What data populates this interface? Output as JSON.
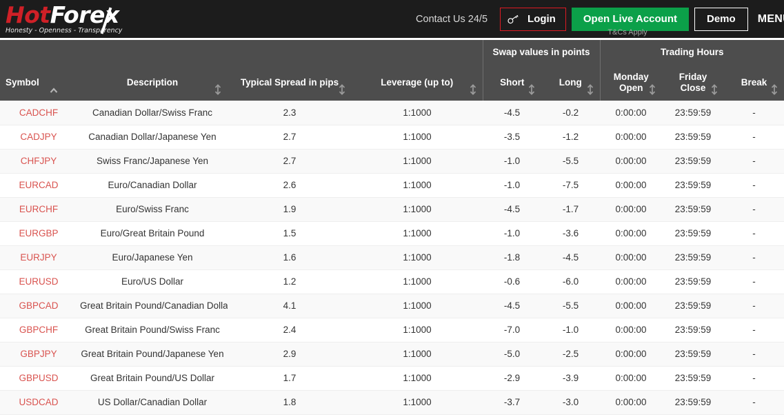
{
  "topbar": {
    "logo": {
      "part1": "Hot",
      "part2": "Forex",
      "tagline": "Honesty - Openness - Transparency"
    },
    "contact": "Contact Us 24/5",
    "login_label": "Login",
    "live_account_label": "Open Live Account",
    "demo_label": "Demo",
    "tcs": "T&Cs Apply",
    "menu_label": "MENU",
    "colors": {
      "accent_red": "#e01a22",
      "accent_green": "#0ba049",
      "bar_bg": "#1c1c1c"
    }
  },
  "table": {
    "group_headers": {
      "swap": "Swap values in points",
      "trading_hours": "Trading Hours"
    },
    "columns": [
      {
        "label": "Symbol",
        "sort": "asc"
      },
      {
        "label": "Description",
        "sort": "none"
      },
      {
        "label": "Typical Spread in pips",
        "sort": "none"
      },
      {
        "label": "Leverage (up to)",
        "sort": "none"
      },
      {
        "label": "Short",
        "sort": "none"
      },
      {
        "label": "Long",
        "sort": "none"
      },
      {
        "label": "Monday Open",
        "sort": "none"
      },
      {
        "label": "Friday Close",
        "sort": "none"
      },
      {
        "label": "Break",
        "sort": "none"
      }
    ],
    "rows": [
      {
        "symbol": "CADCHF",
        "description": "Canadian Dollar/Swiss Franc",
        "spread": "2.3",
        "leverage": "1:1000",
        "short": "-4.5",
        "long": "-0.2",
        "monday_open": "0:00:00",
        "friday_close": "23:59:59",
        "break": "-"
      },
      {
        "symbol": "CADJPY",
        "description": "Canadian Dollar/Japanese Yen",
        "spread": "2.7",
        "leverage": "1:1000",
        "short": "-3.5",
        "long": "-1.2",
        "monday_open": "0:00:00",
        "friday_close": "23:59:59",
        "break": "-"
      },
      {
        "symbol": "CHFJPY",
        "description": "Swiss Franc/Japanese Yen",
        "spread": "2.7",
        "leverage": "1:1000",
        "short": "-1.0",
        "long": "-5.5",
        "monday_open": "0:00:00",
        "friday_close": "23:59:59",
        "break": "-"
      },
      {
        "symbol": "EURCAD",
        "description": "Euro/Canadian Dollar",
        "spread": "2.6",
        "leverage": "1:1000",
        "short": "-1.0",
        "long": "-7.5",
        "monday_open": "0:00:00",
        "friday_close": "23:59:59",
        "break": "-"
      },
      {
        "symbol": "EURCHF",
        "description": "Euro/Swiss Franc",
        "spread": "1.9",
        "leverage": "1:1000",
        "short": "-4.5",
        "long": "-1.7",
        "monday_open": "0:00:00",
        "friday_close": "23:59:59",
        "break": "-"
      },
      {
        "symbol": "EURGBP",
        "description": "Euro/Great Britain Pound",
        "spread": "1.5",
        "leverage": "1:1000",
        "short": "-1.0",
        "long": "-3.6",
        "monday_open": "0:00:00",
        "friday_close": "23:59:59",
        "break": "-"
      },
      {
        "symbol": "EURJPY",
        "description": "Euro/Japanese Yen",
        "spread": "1.6",
        "leverage": "1:1000",
        "short": "-1.8",
        "long": "-4.5",
        "monday_open": "0:00:00",
        "friday_close": "23:59:59",
        "break": "-"
      },
      {
        "symbol": "EURUSD",
        "description": "Euro/US Dollar",
        "spread": "1.2",
        "leverage": "1:1000",
        "short": "-0.6",
        "long": "-6.0",
        "monday_open": "0:00:00",
        "friday_close": "23:59:59",
        "break": "-"
      },
      {
        "symbol": "GBPCAD",
        "description": "Great Britain Pound/Canadian Dollar",
        "spread": "4.1",
        "leverage": "1:1000",
        "short": "-4.5",
        "long": "-5.5",
        "monday_open": "0:00:00",
        "friday_close": "23:59:59",
        "break": "-"
      },
      {
        "symbol": "GBPCHF",
        "description": "Great Britain Pound/Swiss Franc",
        "spread": "2.4",
        "leverage": "1:1000",
        "short": "-7.0",
        "long": "-1.0",
        "monday_open": "0:00:00",
        "friday_close": "23:59:59",
        "break": "-"
      },
      {
        "symbol": "GBPJPY",
        "description": "Great Britain Pound/Japanese Yen",
        "spread": "2.9",
        "leverage": "1:1000",
        "short": "-5.0",
        "long": "-2.5",
        "monday_open": "0:00:00",
        "friday_close": "23:59:59",
        "break": "-"
      },
      {
        "symbol": "GBPUSD",
        "description": "Great Britain Pound/US Dollar",
        "spread": "1.7",
        "leverage": "1:1000",
        "short": "-2.9",
        "long": "-3.9",
        "monday_open": "0:00:00",
        "friday_close": "23:59:59",
        "break": "-"
      },
      {
        "symbol": "USDCAD",
        "description": "US Dollar/Canadian Dollar",
        "spread": "1.8",
        "leverage": "1:1000",
        "short": "-3.7",
        "long": "-3.0",
        "monday_open": "0:00:00",
        "friday_close": "23:59:59",
        "break": "-"
      }
    ]
  }
}
